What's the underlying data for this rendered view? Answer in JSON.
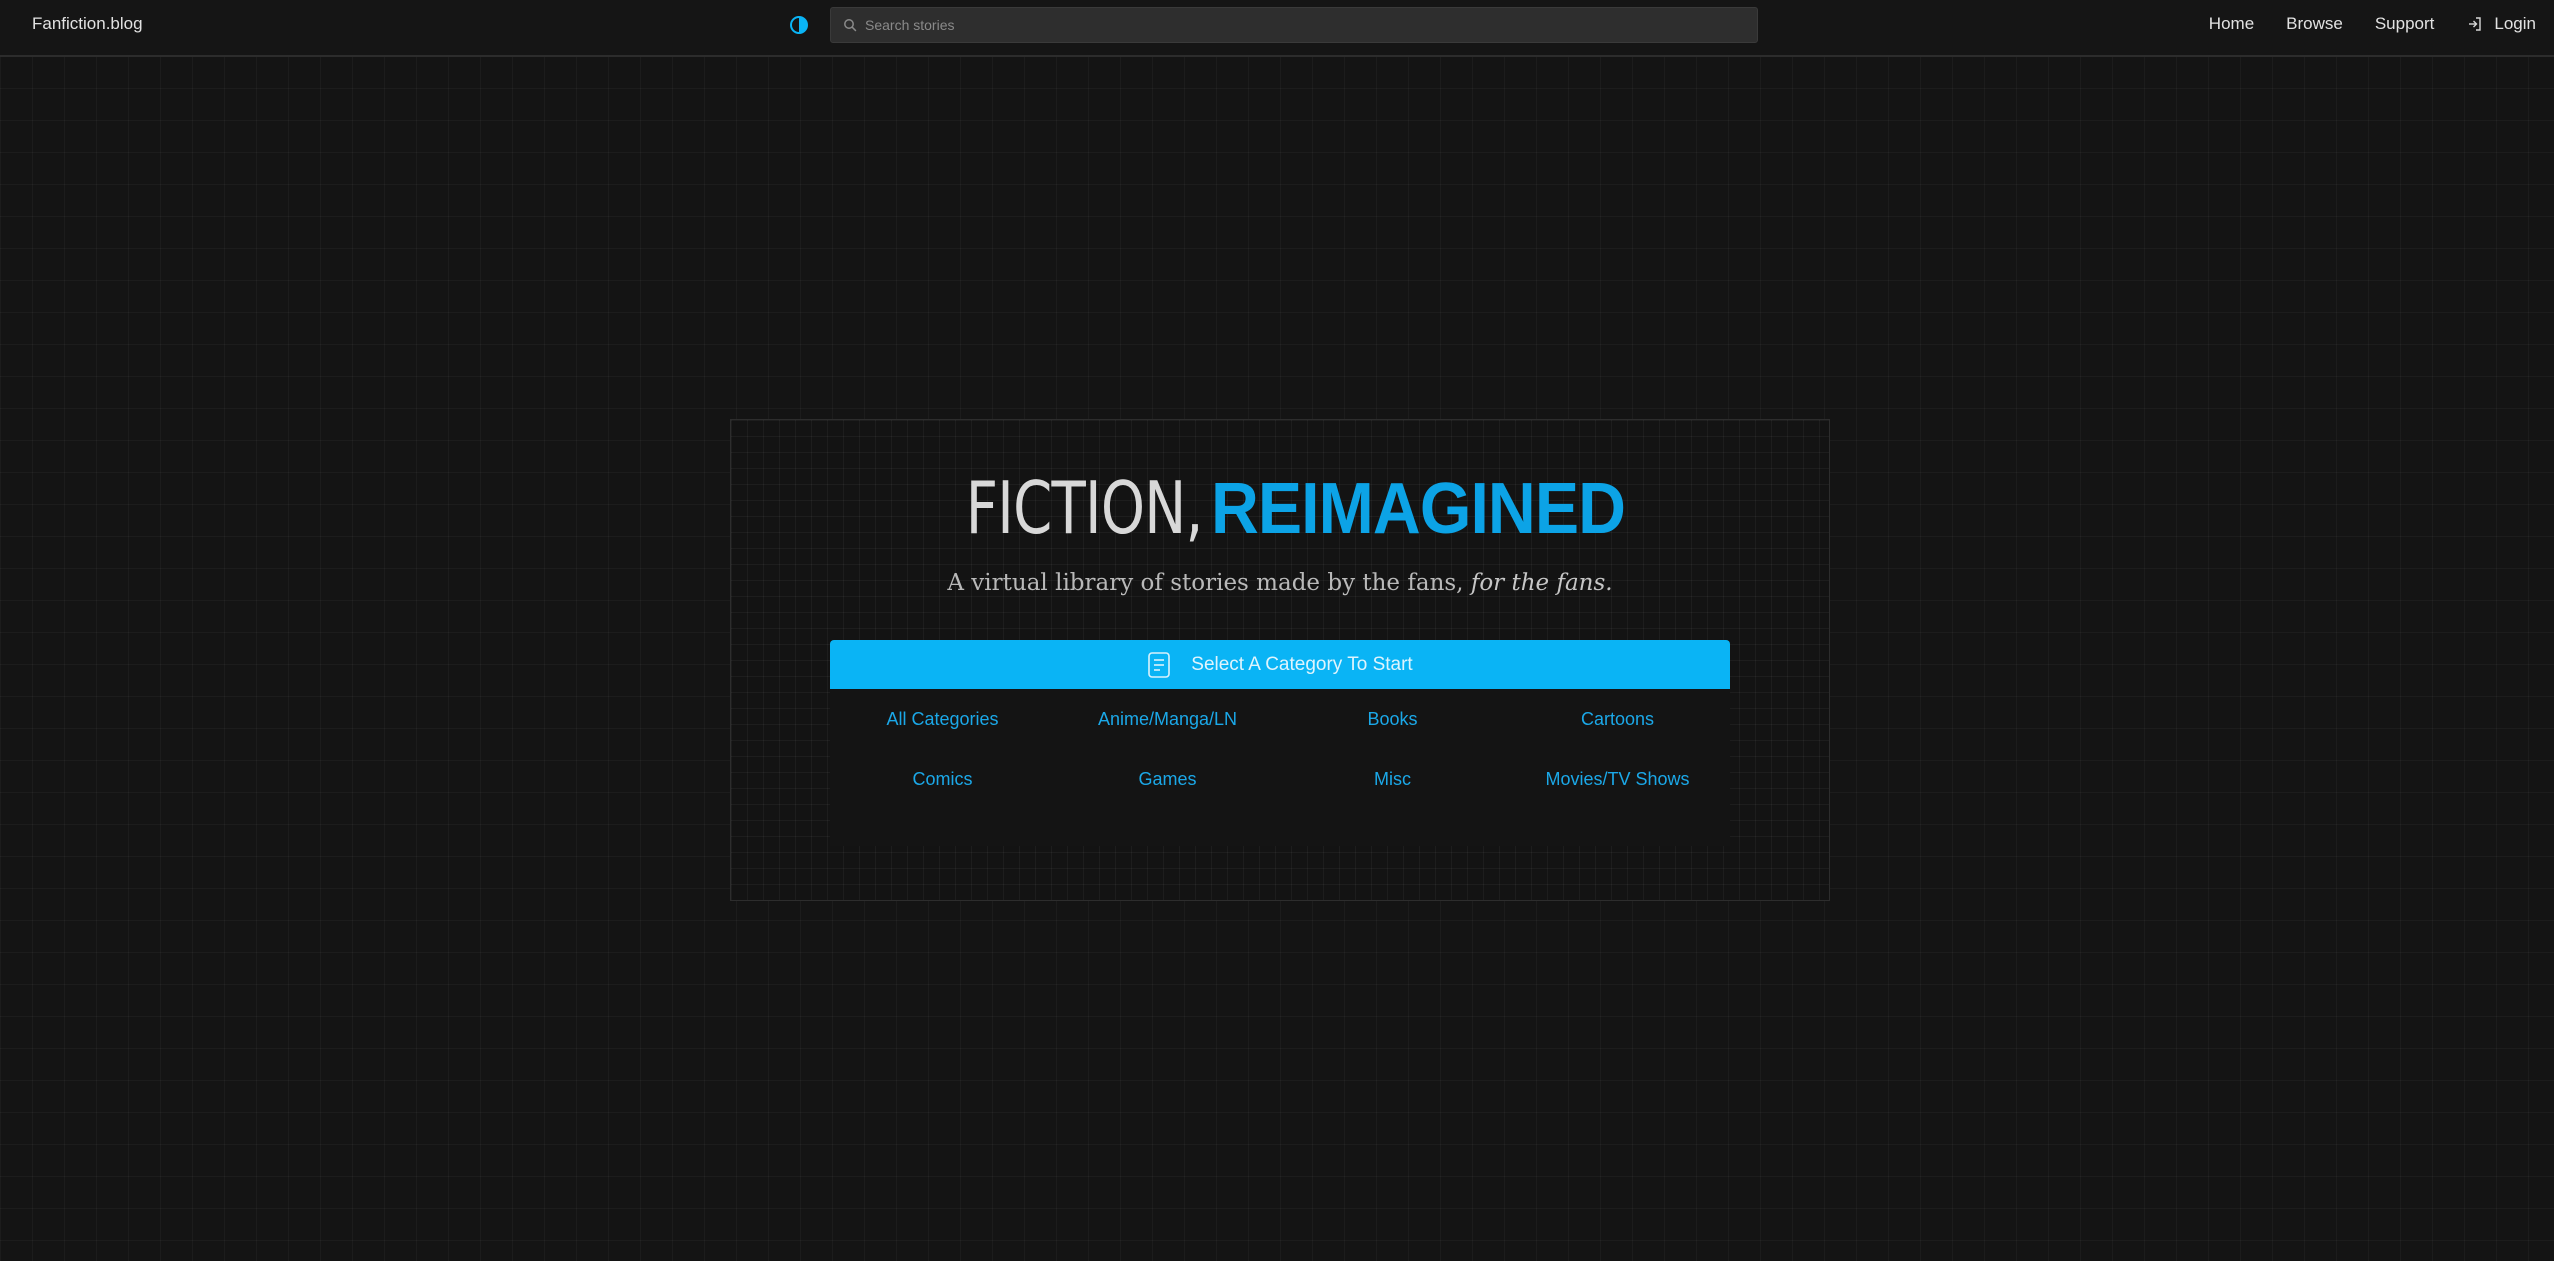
{
  "header": {
    "brand": "Fanfiction.blog",
    "search_placeholder": "Search stories",
    "nav": [
      {
        "label": "Home"
      },
      {
        "label": "Browse"
      },
      {
        "label": "Support"
      },
      {
        "label": "Login",
        "icon": "login-icon"
      }
    ],
    "theme_toggle_icon": "contrast-icon"
  },
  "hero": {
    "title_light": "FICTION,",
    "title_bold": "REIMAGINED",
    "subtitle_main": "A virtual library of stories made by the fans, ",
    "subtitle_em": "for the fans.",
    "category_button_label": "Select A Category To Start",
    "category_button_icon": "document-icon",
    "categories": [
      "All Categories",
      "Anime/Manga/LN",
      "Books",
      "Cartoons",
      "Comics",
      "Games",
      "Misc",
      "Movies/TV Shows"
    ]
  },
  "colors": {
    "accent": "#0ab4f5",
    "title_accent": "#0ca3e6",
    "background": "#141414"
  }
}
